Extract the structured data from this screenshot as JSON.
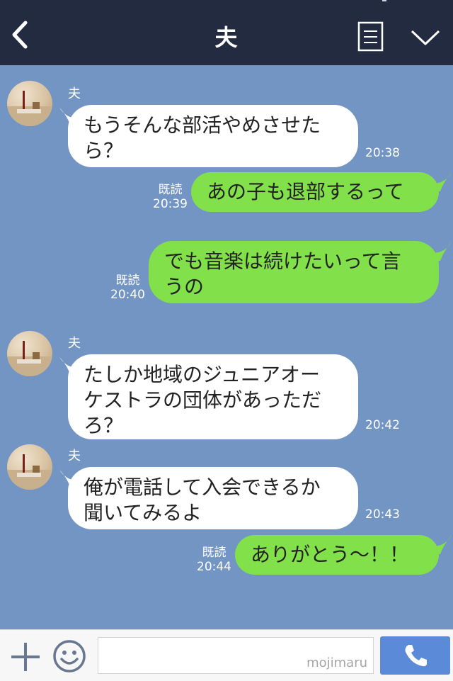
{
  "header": {
    "title": "夫"
  },
  "messages": [
    {
      "from": "夫",
      "side": "in",
      "lines": [
        "もうそんな部活やめさせた",
        "ら？"
      ],
      "time": "20:38"
    },
    {
      "side": "out",
      "lines": [
        "あの子も退部するって"
      ],
      "read": "既読",
      "time": "20:39"
    },
    {
      "side": "out",
      "lines": [
        "でも音楽は続けたいって言",
        "うの"
      ],
      "read": "既読",
      "time": "20:40"
    },
    {
      "from": "夫",
      "side": "in",
      "lines": [
        "たしか地域のジュニアオー",
        "ケストラの団体があっただ",
        "ろ？"
      ],
      "time": "20:42"
    },
    {
      "from": "夫",
      "side": "in",
      "lines": [
        "俺が電話して入会できるか",
        "聞いてみるよ"
      ],
      "time": "20:43"
    },
    {
      "side": "out",
      "lines": [
        "ありがとう〜！！"
      ],
      "read": "既読",
      "time": "20:44"
    }
  ],
  "footer": {
    "watermark": "mojimaru"
  },
  "colors": {
    "header_bg": "#232b40",
    "chat_bg": "#7395c4",
    "incoming_bubble": "#ffffff",
    "outgoing_bubble": "#82e04a",
    "call_button": "#5b8ad8"
  },
  "icons": {
    "back": "chevron-left-icon",
    "menu": "list-icon",
    "collapse": "chevron-down-icon",
    "plus": "plus-icon",
    "emoji": "smiley-icon",
    "call": "phone-icon"
  }
}
